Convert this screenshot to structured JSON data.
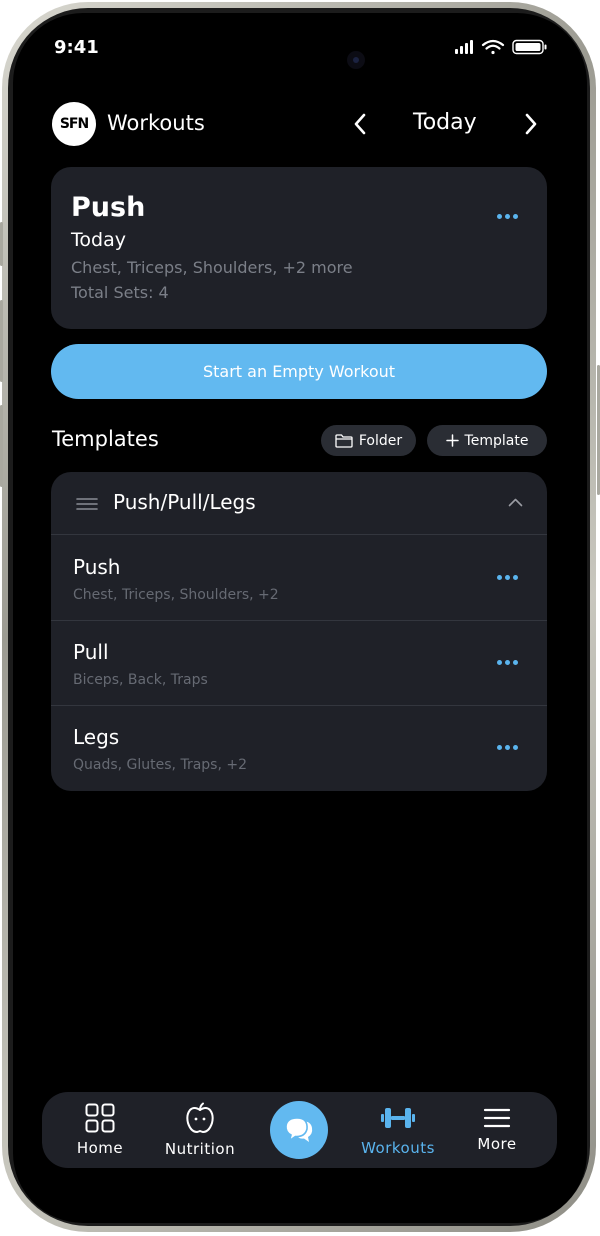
{
  "status": {
    "time": "9:41"
  },
  "header": {
    "logo_text": "SFN",
    "title": "Workouts",
    "date_label": "Today"
  },
  "workout_card": {
    "name": "Push",
    "date": "Today",
    "muscles": "Chest, Triceps, Shoulders, +2 more",
    "total_sets": "Total Sets: 4"
  },
  "start_button_label": "Start an Empty Workout",
  "templates": {
    "heading": "Templates",
    "folder_label": "Folder",
    "add_template_label": "Template",
    "group": {
      "title": "Push/Pull/Legs",
      "items": [
        {
          "name": "Push",
          "muscles": "Chest, Triceps, Shoulders, +2"
        },
        {
          "name": "Pull",
          "muscles": "Biceps, Back, Traps"
        },
        {
          "name": "Legs",
          "muscles": "Quads, Glutes, Traps, +2"
        }
      ]
    }
  },
  "tabbar": {
    "home": "Home",
    "nutrition": "Nutrition",
    "workouts": "Workouts",
    "more": "More",
    "active": "workouts"
  },
  "colors": {
    "accent": "#62b9f0",
    "card": "#1f2128",
    "background": "#000000"
  }
}
